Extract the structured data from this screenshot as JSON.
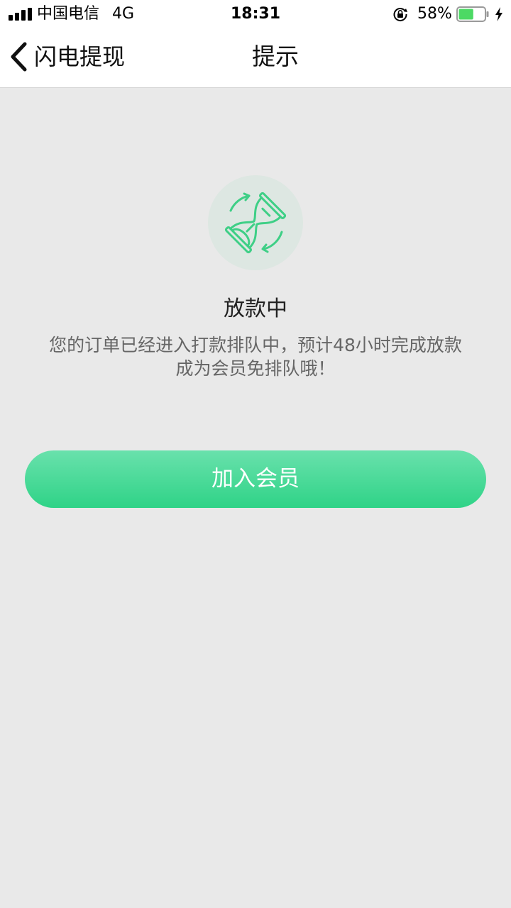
{
  "status_bar": {
    "carrier": "中国电信",
    "network": "4G",
    "time": "18:31",
    "battery_percent": "58%",
    "battery_level": 0.58,
    "battery_color": "#4cd964",
    "icons": [
      "signal-icon",
      "rotation-lock-icon",
      "battery-icon",
      "charging-bolt-icon"
    ]
  },
  "nav": {
    "back_label": "闪电提现",
    "title": "提示",
    "back_icon": "chevron-left-icon"
  },
  "content": {
    "icon": "hourglass-icon",
    "accent_color": "#3ecf86",
    "status_title": "放款中",
    "message_line1": "您的订单已经进入打款排队中，预计48小时完成放款",
    "message_line2": "成为会员免排队哦！",
    "button_label": "加入会员"
  }
}
